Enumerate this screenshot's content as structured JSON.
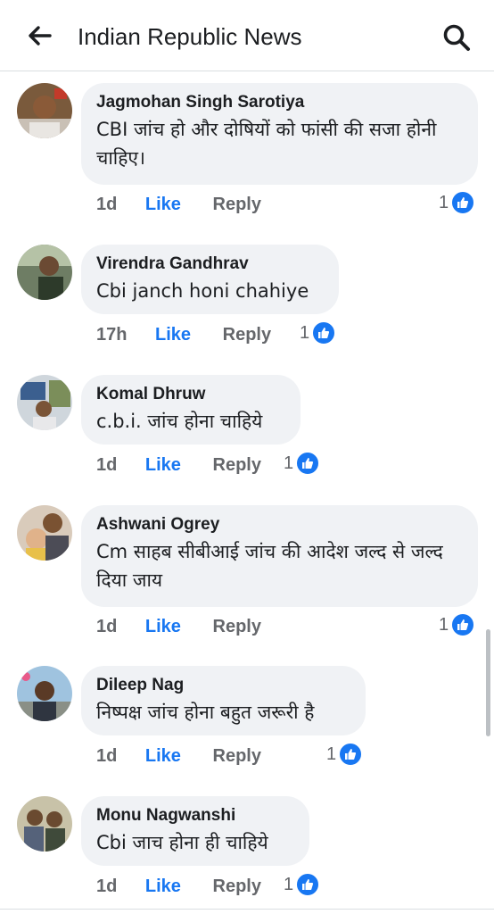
{
  "header": {
    "title": "Indian Republic News"
  },
  "colors": {
    "accent": "#1877f2",
    "bubble": "#f0f2f5",
    "meta": "#65676b"
  },
  "icons": {
    "back": "arrow-left",
    "search": "magnifier",
    "like": "thumbs-up"
  },
  "comments": [
    {
      "author": "Jagmohan Singh Sarotiya",
      "text": "CBI जांच हो और दोषियों को फांसी की सजा होनी चाहिए।",
      "time": "1d",
      "like_label": "Like",
      "reply_label": "Reply",
      "reactions": "1"
    },
    {
      "author": "Virendra Gandhrav",
      "text": "Cbi janch honi chahiye",
      "time": "17h",
      "like_label": "Like",
      "reply_label": "Reply",
      "reactions": "1"
    },
    {
      "author": "Komal Dhruw",
      "text": "c.b.i. जांच होना चाहिये",
      "time": "1d",
      "like_label": "Like",
      "reply_label": "Reply",
      "reactions": "1"
    },
    {
      "author": "Ashwani Ogrey",
      "text": "Cm साहब सीबीआई जांच की आदेश जल्द से जल्द दिया जाय",
      "time": "1d",
      "like_label": "Like",
      "reply_label": "Reply",
      "reactions": "1"
    },
    {
      "author": "Dileep Nag",
      "text": "निष्पक्ष जांच होना बहुत जरूरी है",
      "time": "1d",
      "like_label": "Like",
      "reply_label": "Reply",
      "reactions": "1"
    },
    {
      "author": "Monu Nagwanshi",
      "text": "Cbi जाच होना ही चाहिये",
      "time": "1d",
      "like_label": "Like",
      "reply_label": "Reply",
      "reactions": "1"
    }
  ]
}
